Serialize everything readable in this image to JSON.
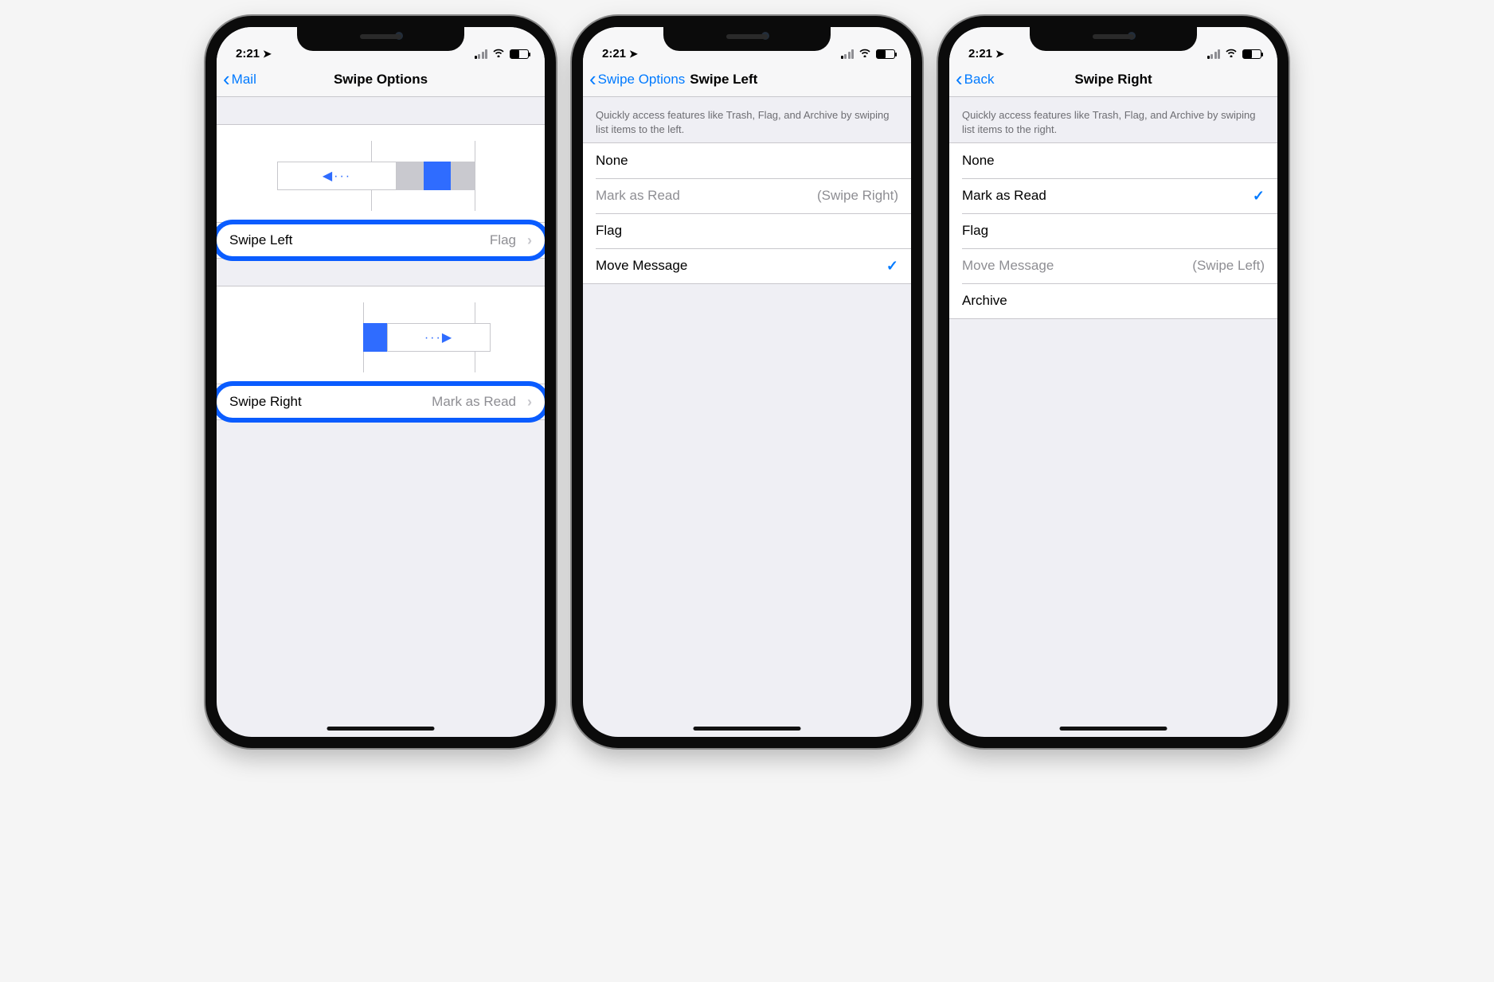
{
  "status": {
    "time": "2:21"
  },
  "screens": [
    {
      "back_label": "Mail",
      "title": "Swipe Options",
      "swipe_left": {
        "label": "Swipe Left",
        "value": "Flag"
      },
      "swipe_right": {
        "label": "Swipe Right",
        "value": "Mark as Read"
      }
    },
    {
      "back_label": "Swipe Options",
      "title": "Swipe Left",
      "description": "Quickly access features like Trash, Flag, and Archive by swiping list items to the left.",
      "options": [
        {
          "label": "None",
          "disabled": false,
          "checked": false
        },
        {
          "label": "Mark as Read",
          "disabled": true,
          "note": "(Swipe Right)"
        },
        {
          "label": "Flag",
          "disabled": false,
          "checked": false
        },
        {
          "label": "Move Message",
          "disabled": false,
          "checked": true
        }
      ]
    },
    {
      "back_label": "Back",
      "title": "Swipe Right",
      "description": "Quickly access features like Trash, Flag, and Archive by swiping list items to the right.",
      "options": [
        {
          "label": "None",
          "disabled": false,
          "checked": false
        },
        {
          "label": "Mark as Read",
          "disabled": false,
          "checked": true
        },
        {
          "label": "Flag",
          "disabled": false,
          "checked": false
        },
        {
          "label": "Move Message",
          "disabled": true,
          "note": "(Swipe Left)"
        },
        {
          "label": "Archive",
          "disabled": false,
          "checked": false
        }
      ]
    }
  ]
}
